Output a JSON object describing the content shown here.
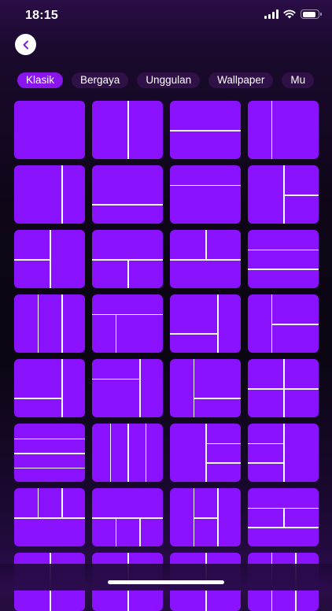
{
  "status_bar": {
    "time": "18:15"
  },
  "header": {
    "back_label": "Back"
  },
  "tabs": [
    {
      "label": "Klasik",
      "active": true
    },
    {
      "label": "Bergaya",
      "active": false
    },
    {
      "label": "Unggulan",
      "active": false
    },
    {
      "label": "Wallpaper",
      "active": false
    },
    {
      "label": "Mu",
      "active": false
    }
  ],
  "colors": {
    "accent": "#8a14ee",
    "tile": "#8a12ff",
    "tab_inactive": "#2f1047",
    "divider": "#ffffff"
  },
  "layouts": [
    [],
    [
      [
        "v",
        0.5,
        0,
        1
      ]
    ],
    [
      [
        "h",
        0.5,
        0,
        1
      ]
    ],
    [
      [
        "v",
        0.333,
        0,
        1
      ]
    ],
    [
      [
        "v",
        0.667,
        0,
        1
      ]
    ],
    [
      [
        "h",
        0.667,
        0,
        1
      ]
    ],
    [
      [
        "h",
        0.333,
        0,
        1
      ]
    ],
    [
      [
        "v",
        0.5,
        0,
        1
      ],
      [
        "h",
        0.5,
        0.5,
        1
      ]
    ],
    [
      [
        "v",
        0.5,
        0,
        1
      ],
      [
        "h",
        0.5,
        0,
        0.5
      ]
    ],
    [
      [
        "h",
        0.5,
        0,
        1
      ],
      [
        "v",
        0.5,
        0.5,
        1
      ]
    ],
    [
      [
        "h",
        0.5,
        0,
        1
      ],
      [
        "v",
        0.5,
        0,
        0.5
      ]
    ],
    [
      [
        "h",
        0.333,
        0,
        1
      ],
      [
        "h",
        0.667,
        0,
        1
      ]
    ],
    [
      [
        "v",
        0.333,
        0,
        1
      ],
      [
        "v",
        0.667,
        0,
        1
      ]
    ],
    [
      [
        "h",
        0.333,
        0,
        1
      ],
      [
        "v",
        0.333,
        0.333,
        1
      ]
    ],
    [
      [
        "v",
        0.667,
        0,
        1
      ],
      [
        "h",
        0.667,
        0,
        0.667
      ]
    ],
    [
      [
        "v",
        0.333,
        0,
        1
      ],
      [
        "h",
        0.5,
        0.333,
        1
      ]
    ],
    [
      [
        "v",
        0.667,
        0,
        1
      ],
      [
        "h",
        0.667,
        0,
        0.667
      ]
    ],
    [
      [
        "v",
        0.667,
        0,
        1
      ],
      [
        "h",
        0.333,
        0,
        0.667
      ]
    ],
    [
      [
        "v",
        0.333,
        0,
        1
      ],
      [
        "h",
        0.667,
        0.333,
        1
      ]
    ],
    [
      [
        "v",
        0.5,
        0,
        1
      ],
      [
        "h",
        0.5,
        0,
        1
      ]
    ],
    [
      [
        "h",
        0.25,
        0,
        1
      ],
      [
        "h",
        0.5,
        0,
        1
      ],
      [
        "h",
        0.75,
        0,
        1
      ]
    ],
    [
      [
        "v",
        0.25,
        0,
        1
      ],
      [
        "v",
        0.5,
        0,
        1
      ],
      [
        "v",
        0.75,
        0,
        1
      ]
    ],
    [
      [
        "v",
        0.5,
        0,
        1
      ],
      [
        "h",
        0.333,
        0.5,
        1
      ],
      [
        "h",
        0.667,
        0.5,
        1
      ]
    ],
    [
      [
        "v",
        0.5,
        0,
        1
      ],
      [
        "h",
        0.333,
        0,
        0.5
      ],
      [
        "h",
        0.667,
        0,
        0.5
      ]
    ],
    [
      [
        "h",
        0.5,
        0,
        1
      ],
      [
        "v",
        0.333,
        0,
        0.5
      ],
      [
        "v",
        0.667,
        0,
        0.5
      ]
    ],
    [
      [
        "h",
        0.5,
        0,
        1
      ],
      [
        "v",
        0.333,
        0.5,
        1
      ],
      [
        "v",
        0.667,
        0.5,
        1
      ]
    ],
    [
      [
        "v",
        0.333,
        0,
        1
      ],
      [
        "v",
        0.667,
        0,
        1
      ],
      [
        "h",
        0.5,
        0.333,
        0.667
      ]
    ],
    [
      [
        "h",
        0.333,
        0,
        1
      ],
      [
        "h",
        0.667,
        0,
        1
      ],
      [
        "v",
        0.5,
        0.333,
        0.667
      ]
    ],
    [
      [
        "v",
        0.5,
        0,
        1
      ]
    ],
    [
      [
        "v",
        0.5,
        0,
        1
      ]
    ],
    [
      [
        "v",
        0.5,
        0,
        1
      ]
    ],
    [
      [
        "v",
        0.333,
        0,
        1
      ],
      [
        "v",
        0.667,
        0,
        1
      ]
    ]
  ]
}
